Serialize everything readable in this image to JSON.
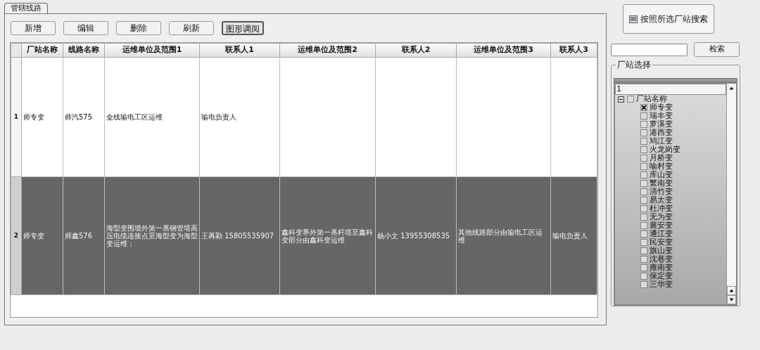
{
  "tab": {
    "label": "管辖线路",
    "selected": true
  },
  "toolbar": [
    "新增",
    "编辑",
    "删除",
    "刷新",
    "图形调阅"
  ],
  "table": {
    "columns": [
      "厂站名称",
      "线路名称",
      "运维单位及范围1",
      "联系人1",
      "运维单位及范围2",
      "联系人2",
      "运维单位及范围3",
      "联系人3"
    ],
    "rows": [
      {
        "number": "1",
        "selected": false,
        "cells": [
          "师专变",
          "师汽575",
          "全线输电工区运维",
          "输电负责人",
          "",
          "",
          "",
          ""
        ]
      },
      {
        "number": "2",
        "selected": true,
        "cells": [
          "师专变",
          "师鑫576",
          "海型变围墙外第一基钢管塔高压电缆连接点至海型变为海型变运维；",
          "王再勤  15805535907",
          "鑫科变界外第一基杆塔至鑫科变部分由鑫科变运维",
          "杨小文  13955308535",
          "其他线路部分由输电工区运维",
          "输电负责人"
        ]
      }
    ]
  },
  "search_by_station_button": "按照所选厂站搜索",
  "search": {
    "button": "检索"
  },
  "station_group": {
    "title": "厂站选择",
    "filter_row": "1",
    "tree": {
      "label": "厂站名称",
      "expanded": true,
      "checked": false,
      "children": [
        {
          "label": "师专变",
          "checked": true
        },
        {
          "label": "瑞丰变",
          "checked": false
        },
        {
          "label": "萝溪变",
          "checked": false
        },
        {
          "label": "港西变",
          "checked": false
        },
        {
          "label": "鸠江变",
          "checked": false
        },
        {
          "label": "火龙岗变",
          "checked": false
        },
        {
          "label": "月桥变",
          "checked": false
        },
        {
          "label": "喻村变",
          "checked": false
        },
        {
          "label": "库山变",
          "checked": false
        },
        {
          "label": "繁南变",
          "checked": false
        },
        {
          "label": "清竹变",
          "checked": false
        },
        {
          "label": "易太变",
          "checked": false
        },
        {
          "label": "杜冲变",
          "checked": false
        },
        {
          "label": "无为变",
          "checked": false
        },
        {
          "label": "襄安变",
          "checked": false
        },
        {
          "label": "通江变",
          "checked": false
        },
        {
          "label": "民安变",
          "checked": false
        },
        {
          "label": "旗山变",
          "checked": false
        },
        {
          "label": "沈巷变",
          "checked": false
        },
        {
          "label": "雍南变",
          "checked": false
        },
        {
          "label": "保定变",
          "checked": false
        },
        {
          "label": "三华变",
          "checked": false
        }
      ]
    }
  }
}
